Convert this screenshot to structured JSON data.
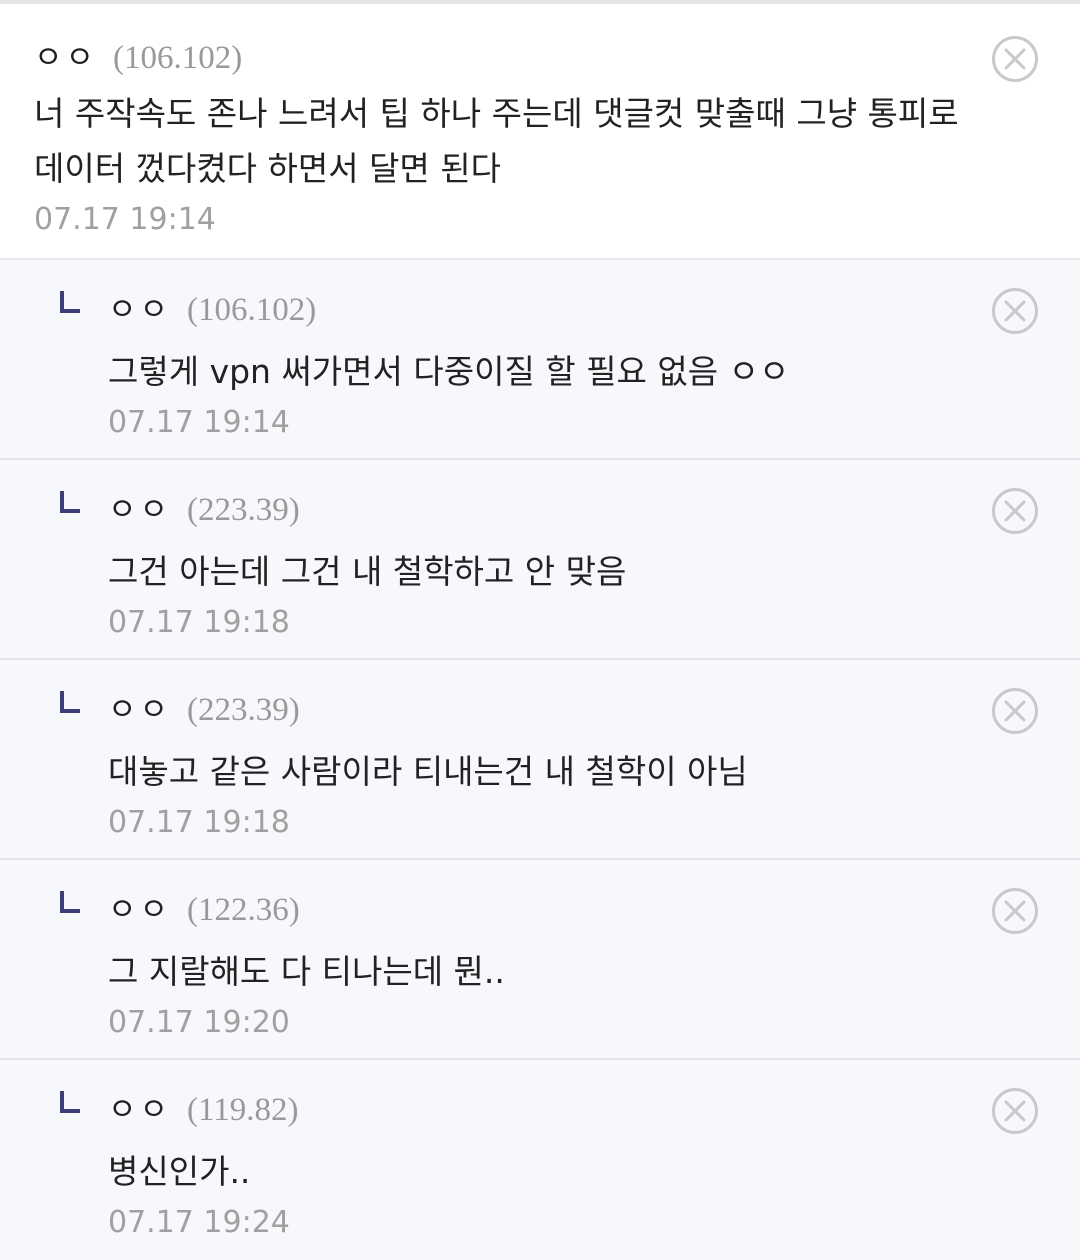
{
  "comments": [
    {
      "nick": "ㅇㅇ",
      "ip": "(106.102)",
      "text": "너 주작속도 존나 느려서 팁 하나 주는데 댓글컷 맞출때 그냥 통피로 데이터 껐다켰다 하면서 달면 된다",
      "date": "07.17 19:14"
    }
  ],
  "replies": [
    {
      "nick": "ㅇㅇ",
      "ip": "(106.102)",
      "text": "그렇게 vpn 써가면서 다중이질 할 필요 없음 ㅇㅇ",
      "date": "07.17 19:14"
    },
    {
      "nick": "ㅇㅇ",
      "ip": "(223.39)",
      "text": "그건 아는데 그건 내 철학하고 안 맞음",
      "date": "07.17 19:18"
    },
    {
      "nick": "ㅇㅇ",
      "ip": "(223.39)",
      "text": "대놓고 같은 사람이라 티내는건 내 철학이 아님",
      "date": "07.17 19:18"
    },
    {
      "nick": "ㅇㅇ",
      "ip": "(122.36)",
      "text": "그 지랄해도 다 티나는데 뭔..",
      "date": "07.17 19:20"
    },
    {
      "nick": "ㅇㅇ",
      "ip": "(119.82)",
      "text": "병신인가..",
      "date": "07.17 19:24"
    }
  ],
  "icons": {
    "delete": "close-circle-icon",
    "reply": "reply-arrow-icon"
  },
  "colors": {
    "reply_background": "#f7f8fb",
    "reply_arrow": "#3d3f77",
    "meta_gray": "#999999"
  }
}
